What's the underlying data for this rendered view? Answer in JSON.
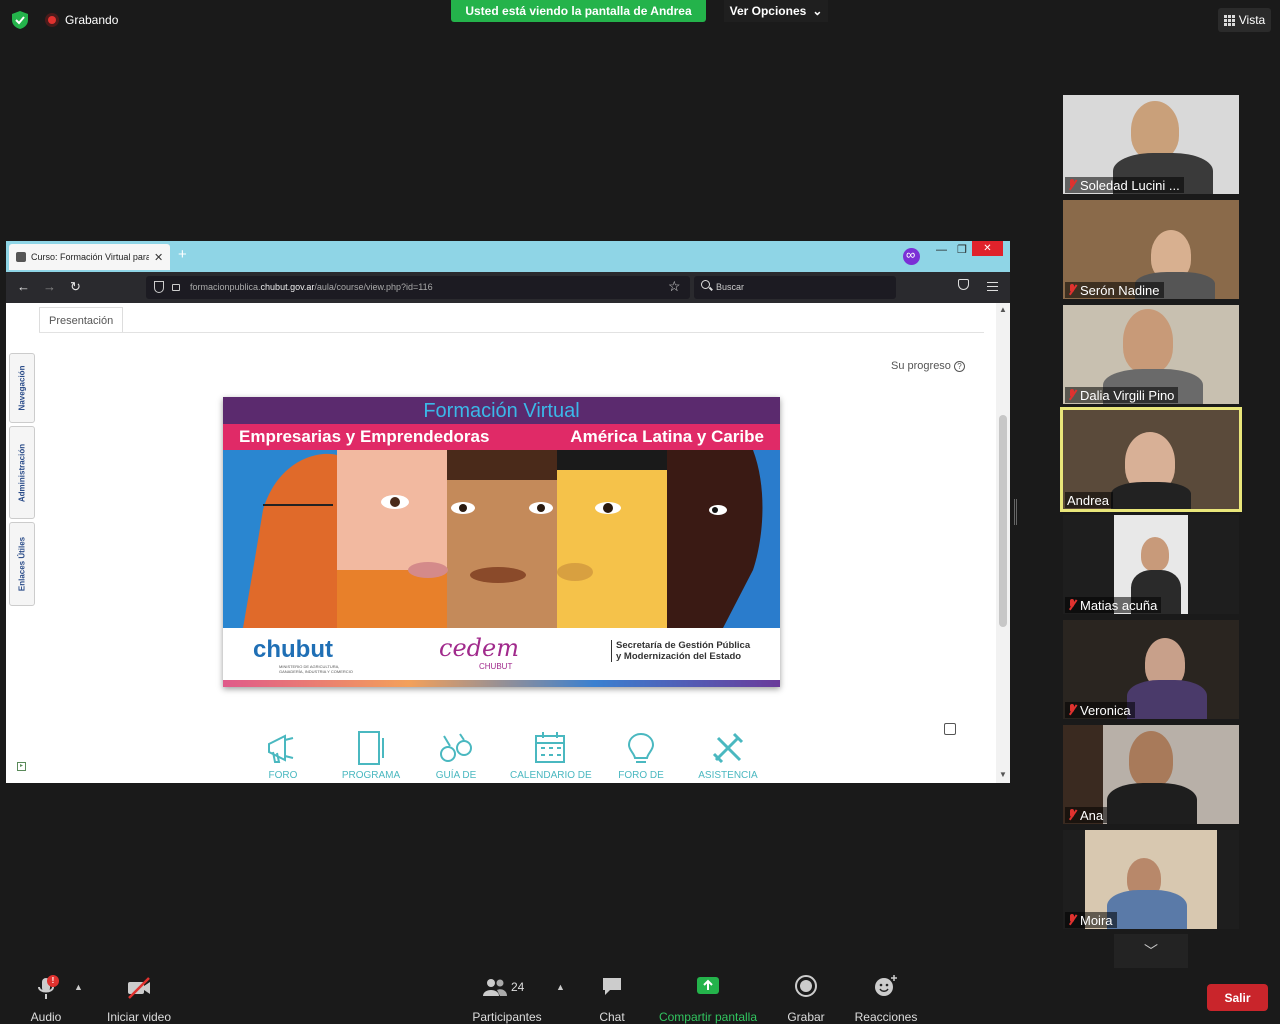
{
  "top_bar": {
    "recording_label": "Grabando",
    "viewing_banner": "Usted está viendo la pantalla de Andrea",
    "view_options_label": "Ver Opciones",
    "view_label": "Vista"
  },
  "browser": {
    "tab_title": "Curso: Formación Virtual para E",
    "url_prefix": "formacionpublica.",
    "url_domain": "chubut.gov.ar",
    "url_path": "/aula/course/view.php?id=116",
    "search_placeholder": "Buscar"
  },
  "course_page": {
    "section_tab": "Presentación",
    "progress_label": "Su progreso",
    "side_tabs": [
      "Navegación",
      "Administración",
      "Enlaces Útiles"
    ],
    "banner": {
      "title": "Formación Virtual",
      "subtitle_left": "Empresarias y Emprendedoras",
      "subtitle_right": "América Latina y Caribe",
      "logo_chubut": "chubut",
      "logo_chubut_sub": "MINISTERIO DE AGRICULTURA, GANADERÍA, INDUSTRIA Y COMERCIO",
      "logo_cedem": "cedem",
      "logo_cedem_sub": "CHUBUT",
      "secretaria_line1": "Secretaría de Gestión Pública",
      "secretaria_line2": "y Modernización del Estado"
    },
    "course_icons": [
      "FORO",
      "PROGRAMA",
      "GUÍA DE",
      "CALENDARIO DE",
      "FORO DE",
      "ASISTENCIA"
    ]
  },
  "participants": [
    {
      "name": "Soledad Lucini ...",
      "muted": true
    },
    {
      "name": "Serón Nadine",
      "muted": true
    },
    {
      "name": "Dalia Virgili Pino",
      "muted": true
    },
    {
      "name": "Andrea",
      "muted": false,
      "active_speaker": true
    },
    {
      "name": "Matias acuña",
      "muted": true
    },
    {
      "name": "Veronica",
      "muted": true
    },
    {
      "name": "Ana",
      "muted": true
    },
    {
      "name": "Moira",
      "muted": true
    }
  ],
  "bottom_bar": {
    "audio_label": "Audio",
    "audio_badge": "!",
    "video_label": "Iniciar video",
    "participants_label": "Participantes",
    "participants_count": "24",
    "chat_label": "Chat",
    "share_label": "Compartir pantalla",
    "record_label": "Grabar",
    "reactions_label": "Reacciones",
    "leave_label": "Salir"
  },
  "colors": {
    "share_green": "#24b34b",
    "leave_red": "#c9252b",
    "active_speaker_outline": "#e9e67a"
  }
}
